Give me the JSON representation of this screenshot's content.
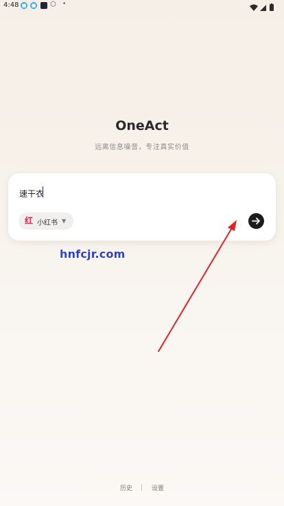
{
  "status_bar": {
    "time": "4:48",
    "icons": [
      "app-blue-icon",
      "app-blue-icon",
      "app-dark-icon",
      "cube-icon",
      "dot-icon"
    ],
    "right_icons": [
      "wifi-icon",
      "signal-icon",
      "battery-icon"
    ]
  },
  "header": {
    "title": "OneAct",
    "subtitle": "远离信息噪音，专注真实价值"
  },
  "search": {
    "value": "速干衣",
    "source": {
      "logo_text": "红",
      "label": "小红书",
      "selected_icon": "xiaohongshu-logo-icon"
    },
    "send_icon": "arrow-right-icon"
  },
  "watermark": "hnfcjr.com",
  "annotation": {
    "color": "#e32222",
    "type": "arrow"
  },
  "footer": {
    "history_label": "历史",
    "settings_label": "设置"
  }
}
